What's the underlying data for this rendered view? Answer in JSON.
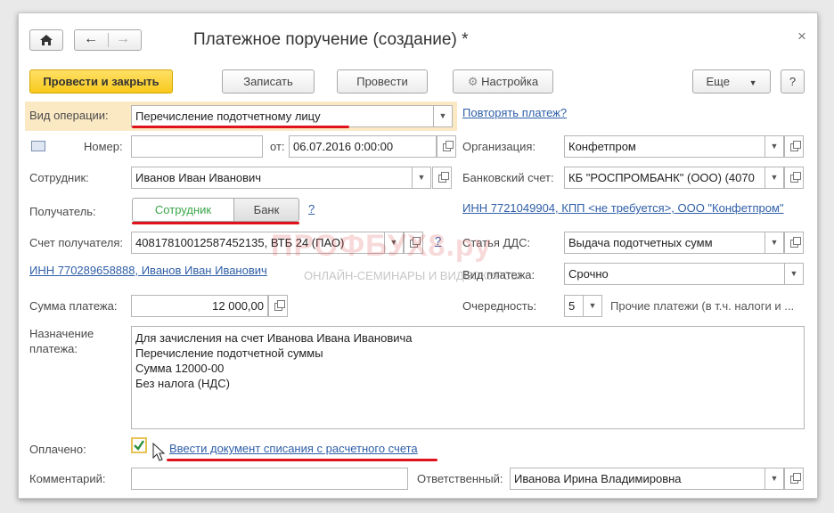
{
  "window": {
    "title": "Платежное поручение (создание) *",
    "close_glyph": "×"
  },
  "toolbar": {
    "post_close": "Провести и закрыть",
    "save": "Записать",
    "post": "Провести",
    "settings": "Настройка",
    "more": "Еще",
    "help": "?"
  },
  "operation": {
    "label": "Вид операции:",
    "value": "Перечисление подотчетному лицу",
    "repeat_link": "Повторять платеж?"
  },
  "number": {
    "label": "Номер:",
    "value": "",
    "date_label": "от:",
    "date_value": "06.07.2016  0:00:00"
  },
  "organization": {
    "label": "Организация:",
    "value": "Конфетпром"
  },
  "employee": {
    "label": "Сотрудник:",
    "value": "Иванов Иван Иванович"
  },
  "bank_account": {
    "label": "Банковский счет:",
    "value": "КБ \"РОСПРОМБАНК\" (ООО) (4070"
  },
  "recipient": {
    "label": "Получатель:",
    "tab_employee": "Сотрудник",
    "tab_bank": "Банк",
    "help": "?"
  },
  "inn_org_link": "ИНН 7721049904, КПП <не требуется>, ООО \"Конфетпром\"",
  "recipient_account": {
    "label": "Счет получателя:",
    "value": "40817810012587452135, ВТБ 24 (ПАО)",
    "help": "?"
  },
  "dds": {
    "label": "Статья ДДС:",
    "value": "Выдача подотчетных сумм"
  },
  "inn_person_link": "ИНН 770289658888, Иванов Иван Иванович",
  "payment_type": {
    "label": "Вид платежа:",
    "value": "Срочно"
  },
  "amount": {
    "label": "Сумма платежа:",
    "value": "12 000,00"
  },
  "priority": {
    "label": "Очередность:",
    "value": "5",
    "description": "Прочие платежи (в т.ч. налоги и ..."
  },
  "purpose": {
    "label_line1": "Назначение",
    "label_line2": "платежа:",
    "text": "Для зачисления на счет Иванова Ивана Ивановича\nПеречисление подотчетной суммы\nСумма 12000-00\nБез налога (НДС)"
  },
  "paid": {
    "label": "Оплачено:",
    "checked": true,
    "link": "Ввести документ списания с расчетного счета"
  },
  "comment": {
    "label": "Комментарий:",
    "value": ""
  },
  "responsible": {
    "label": "Ответственный:",
    "value": "Иванова Ирина Владимировна"
  },
  "watermark": {
    "logo": "ПРОФБУХ8.ру",
    "tagline": "ОНЛАЙН-СЕМИНАРЫ И ВИДЕОКУРСЫ"
  },
  "colors": {
    "primary_button": "#f8c91c",
    "highlight_row": "#fbe9c4",
    "underline_red": "#e0121b",
    "link": "#2f5ea8",
    "tab_active_text": "#3aa54a"
  },
  "icons": [
    "home-icon",
    "back-arrow-icon",
    "forward-arrow-icon",
    "gear-icon",
    "calendar-icon",
    "calculator-icon",
    "open-form-icon",
    "dropdown-arrow-icon",
    "checkbox-icon",
    "mouse-cursor-icon",
    "close-icon"
  ]
}
